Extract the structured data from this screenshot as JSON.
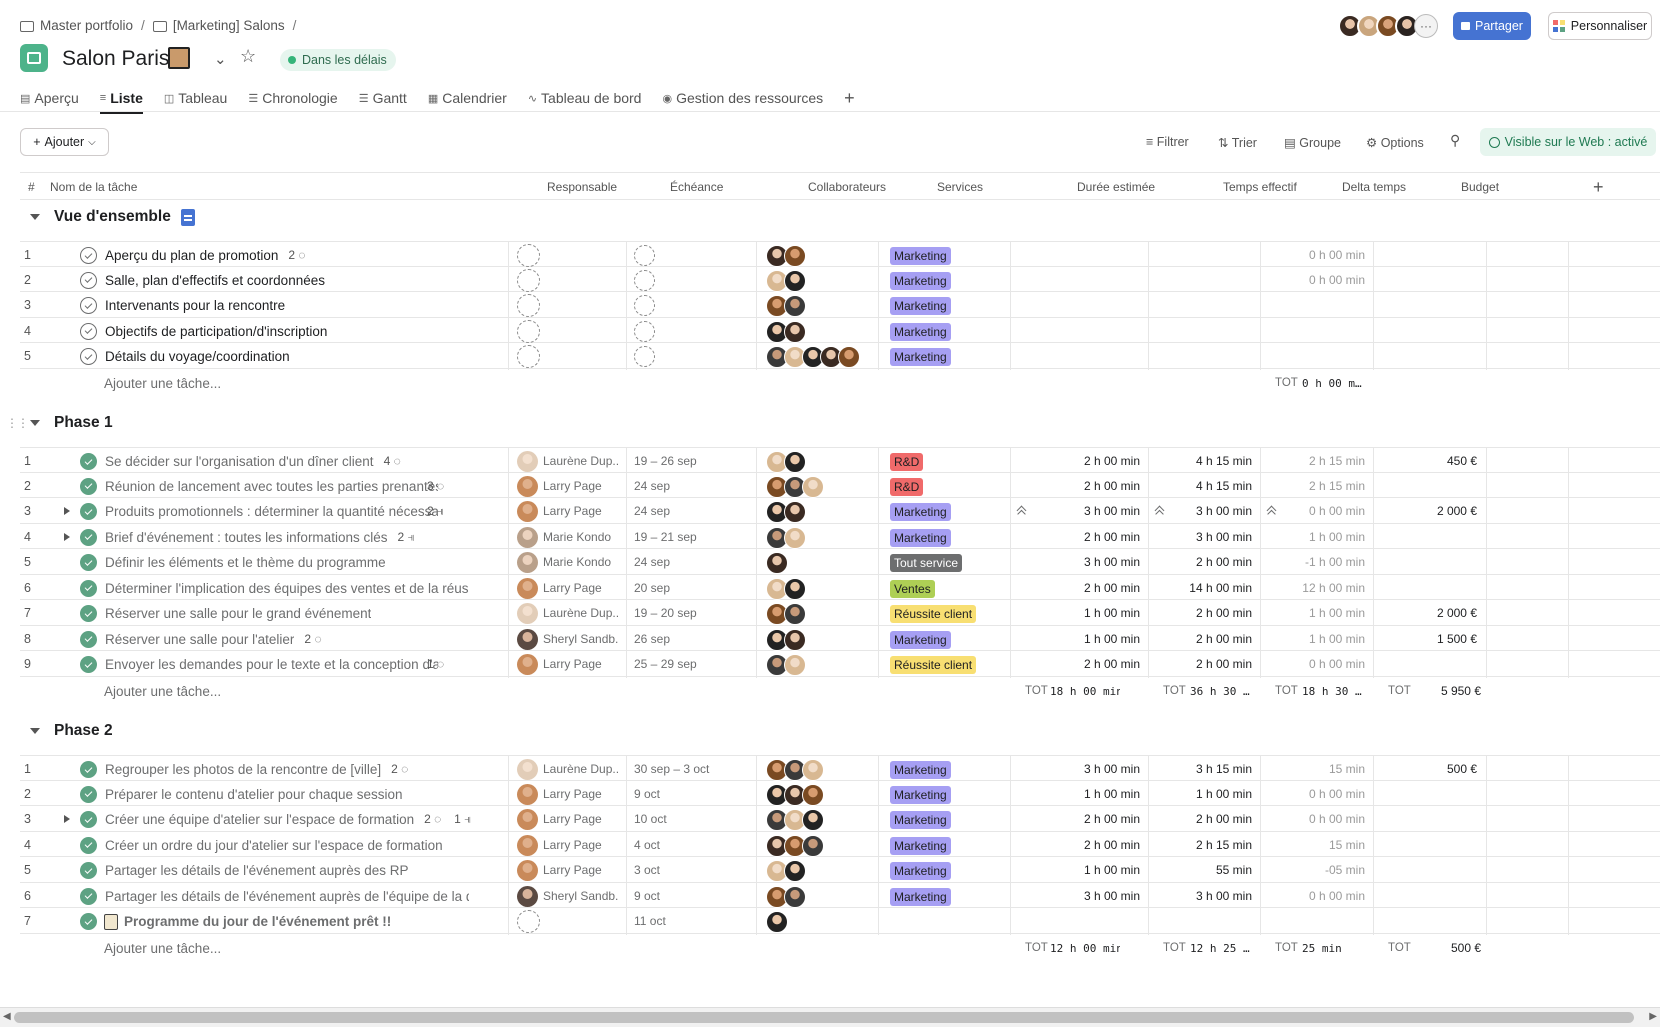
{
  "breadcrumb": {
    "items": [
      "Master portfolio",
      "[Marketing] Salons"
    ],
    "sep": "/"
  },
  "project": {
    "title": "Salon Paris",
    "status": "Dans les délais"
  },
  "header_actions": {
    "share": "Partager",
    "customize": "Personnaliser",
    "more": "···"
  },
  "tabs": [
    "Aperçu",
    "Liste",
    "Tableau",
    "Chronologie",
    "Gantt",
    "Calendrier",
    "Tableau de bord",
    "Gestion des ressources"
  ],
  "add_tab": "+",
  "toolbar": {
    "add": "Ajouter",
    "filter": "Filtrer",
    "sort": "Trier",
    "group": "Groupe",
    "options": "Options",
    "visible": "Visible sur le Web : activé"
  },
  "columns": {
    "num": "#",
    "name": "Nom de la tâche",
    "assignee": "Responsable",
    "due": "Échéance",
    "collabs": "Collaborateurs",
    "services": "Services",
    "est": "Durée estimée",
    "actual": "Temps effectif",
    "delta": "Delta temps",
    "budget": "Budget",
    "add": "+"
  },
  "add_task": "Ajouter une tâche...",
  "tot_label": "TOT",
  "colors": {
    "accent": "#4573d2",
    "green": "#5da283",
    "marketing": "#a69ff3",
    "rd": "#f06a6a",
    "ventes": "#aecf55",
    "reussite": "#f8df72",
    "tout": "#6d6e6f"
  },
  "sections": [
    {
      "title": "Vue d'ensemble",
      "tot": {
        "delta": "0 h 00 m…"
      },
      "tasks": [
        {
          "n": "1",
          "name": "Aperçu du plan de promotion",
          "done": false,
          "comments": "2",
          "delta": "0 h 00 min",
          "tag": "Marketing",
          "tagc": "mk",
          "collabs": 2
        },
        {
          "n": "2",
          "name": "Salle, plan d'effectifs et coordonnées",
          "done": false,
          "delta": "0 h 00 min",
          "tag": "Marketing",
          "tagc": "mk",
          "collabs": 2
        },
        {
          "n": "3",
          "name": "Intervenants pour la rencontre",
          "done": false,
          "tag": "Marketing",
          "tagc": "mk",
          "collabs": 2
        },
        {
          "n": "4",
          "name": "Objectifs de participation/d'inscription",
          "done": false,
          "tag": "Marketing",
          "tagc": "mk",
          "collabs": 2
        },
        {
          "n": "5",
          "name": "Détails du voyage/coordination",
          "done": false,
          "tag": "Marketing",
          "tagc": "mk",
          "collabs": 5
        }
      ]
    },
    {
      "title": "Phase 1",
      "tot": {
        "est": "18 h 00 min",
        "actual": "36 h 30 …",
        "delta": "18 h 30 …",
        "budget": "5 950 €"
      },
      "tasks": [
        {
          "n": "1",
          "name": "Se décider sur l'organisation d'un dîner client",
          "done": true,
          "comments": "4",
          "assignee": "Laurène Dup...",
          "due": "19 – 26 sep",
          "tag": "R&D",
          "tagc": "rd",
          "est": "2 h 00 min",
          "actual": "4 h 15 min",
          "delta": "2 h 15 min",
          "budget": "450 €",
          "collabs": 2
        },
        {
          "n": "2",
          "name": "Réunion de lancement avec toutes les parties prenantes",
          "done": true,
          "comments": "3",
          "assignee": "Larry Page",
          "due": "24 sep",
          "tag": "R&D",
          "tagc": "rd",
          "est": "2 h 00 min",
          "actual": "4 h 15 min",
          "delta": "2 h 15 min",
          "collabs": 3
        },
        {
          "n": "3",
          "name": "Produits promotionnels : déterminer la quantité nécessaire",
          "done": true,
          "subtasks": "2",
          "expand": true,
          "assignee": "Larry Page",
          "due": "24 sep",
          "tag": "Marketing",
          "tagc": "mk",
          "est": "3 h 00 min",
          "actual": "3 h 00 min",
          "delta": "0 h 00 min",
          "budget": "2 000 €",
          "collabs": 2,
          "chev": true
        },
        {
          "n": "4",
          "name": "Brief d'événement : toutes les informations clés",
          "done": true,
          "subtasks": "2",
          "expand": true,
          "assignee": "Marie Kondo",
          "due": "19 – 21 sep",
          "tag": "Marketing",
          "tagc": "mk",
          "est": "2 h 00 min",
          "actual": "3 h 00 min",
          "delta": "1 h 00 min",
          "collabs": 2
        },
        {
          "n": "5",
          "name": "Définir les éléments et le thème du programme",
          "done": true,
          "assignee": "Marie Kondo",
          "due": "24 sep",
          "tag": "Tout service",
          "tagc": "ts",
          "est": "3 h 00 min",
          "actual": "2 h 00 min",
          "delta": "-1 h 00 min",
          "collabs": 1
        },
        {
          "n": "6",
          "name": "Déterminer l'implication des équipes des ventes et de la réussite client",
          "done": true,
          "assignee": "Larry Page",
          "due": "20 sep",
          "tag": "Ventes",
          "tagc": "vt",
          "est": "2 h 00 min",
          "actual": "14 h 00 min",
          "delta": "12 h 00 min",
          "collabs": 2
        },
        {
          "n": "7",
          "name": "Réserver une salle pour le grand événement",
          "done": true,
          "assignee": "Laurène Dup...",
          "due": "19 – 20 sep",
          "tag": "Réussite client",
          "tagc": "rc",
          "est": "1 h 00 min",
          "actual": "2 h 00 min",
          "delta": "1 h 00 min",
          "budget": "2 000 €",
          "collabs": 2
        },
        {
          "n": "8",
          "name": "Réserver une salle pour l'atelier",
          "done": true,
          "comments": "2",
          "assignee": "Sheryl Sandb...",
          "due": "26 sep",
          "tag": "Marketing",
          "tagc": "mk",
          "est": "1 h 00 min",
          "actual": "2 h 00 min",
          "delta": "1 h 00 min",
          "budget": "1 500 €",
          "collabs": 2
        },
        {
          "n": "9",
          "name": "Envoyer les demandes pour le texte et la conception d'affiche",
          "done": true,
          "comments": "1",
          "assignee": "Larry Page",
          "due": "25 – 29 sep",
          "tag": "Réussite client",
          "tagc": "rc",
          "est": "2 h 00 min",
          "actual": "2 h 00 min",
          "delta": "0 h 00 min",
          "collabs": 2
        }
      ]
    },
    {
      "title": "Phase 2",
      "tot": {
        "est": "12 h 00 min",
        "actual": "12 h 25 …",
        "delta": "25 min",
        "budget": "500 €"
      },
      "tasks": [
        {
          "n": "1",
          "name": "Regrouper les photos de la rencontre de [ville]",
          "done": true,
          "comments": "2",
          "assignee": "Laurène Dup...",
          "due": "30 sep – 3 oct",
          "tag": "Marketing",
          "tagc": "mk",
          "est": "3 h 00 min",
          "actual": "3 h 15 min",
          "delta": "15 min",
          "budget": "500 €",
          "collabs": 3
        },
        {
          "n": "2",
          "name": "Préparer le contenu d'atelier pour chaque session",
          "done": true,
          "assignee": "Larry Page",
          "due": "9 oct",
          "tag": "Marketing",
          "tagc": "mk",
          "est": "1 h 00 min",
          "actual": "1 h 00 min",
          "delta": "0 h 00 min",
          "collabs": 3
        },
        {
          "n": "3",
          "name": "Créer une équipe d'atelier sur l'espace de formation",
          "done": true,
          "comments": "2",
          "subtasks": "1",
          "expand": true,
          "assignee": "Larry Page",
          "due": "10 oct",
          "tag": "Marketing",
          "tagc": "mk",
          "est": "2 h 00 min",
          "actual": "2 h 00 min",
          "delta": "0 h 00 min",
          "collabs": 3
        },
        {
          "n": "4",
          "name": "Créer un ordre du jour d'atelier sur l'espace de formation",
          "done": true,
          "assignee": "Larry Page",
          "due": "4 oct",
          "tag": "Marketing",
          "tagc": "mk",
          "est": "2 h 00 min",
          "actual": "2 h 15 min",
          "delta": "15 min",
          "collabs": 3
        },
        {
          "n": "5",
          "name": "Partager les détails de l'événement auprès des RP",
          "done": true,
          "assignee": "Larry Page",
          "due": "3 oct",
          "tag": "Marketing",
          "tagc": "mk",
          "est": "1 h 00 min",
          "actual": "55 min",
          "delta": "-05 min",
          "collabs": 2
        },
        {
          "n": "6",
          "name": "Partager les détails de l'événement auprès de l'équipe de la direction",
          "done": true,
          "assignee": "Sheryl Sandb...",
          "due": "9 oct",
          "tag": "Marketing",
          "tagc": "mk",
          "est": "3 h 00 min",
          "actual": "3 h 00 min",
          "delta": "0 h 00 min",
          "collabs": 2
        },
        {
          "n": "7",
          "name": "Programme du jour de l'événement prêt !!",
          "done": true,
          "milestone": true,
          "due": "11 oct",
          "collabs": 1
        }
      ]
    }
  ]
}
